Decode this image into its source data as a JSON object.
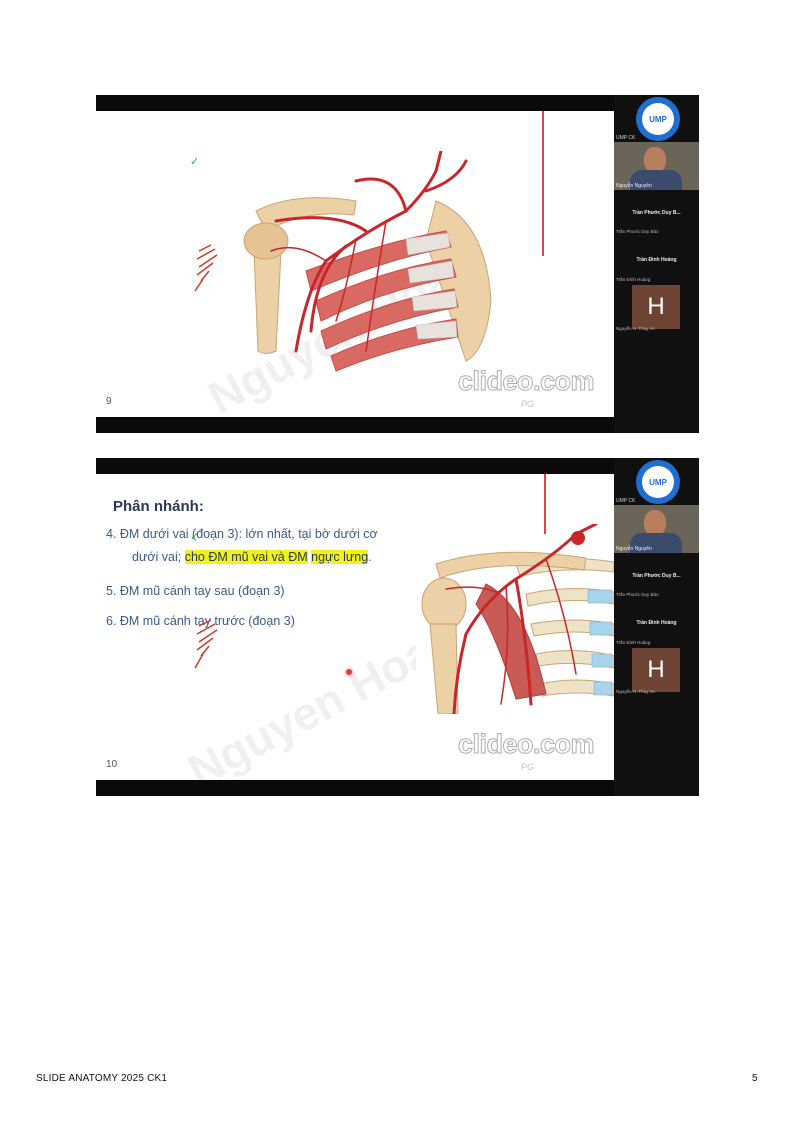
{
  "slide1": {
    "page_number": "9",
    "watermark": "clideo.com",
    "sidebar": {
      "org_label": "UMP CK",
      "camera_label": "Nguyễn Nguyên",
      "participants": [
        {
          "name": "Trần Phước Duy B...",
          "sub": "Trần Phước Duy Bảo"
        },
        {
          "name": "Trần Đình Hoàng",
          "sub": "Trần Đình Hoàng"
        }
      ],
      "avatar_letter": "H",
      "avatar_label": "Nguyễn H. Thuỵ An"
    }
  },
  "slide2": {
    "page_number": "10",
    "heading": "Phân nhánh:",
    "items": {
      "item4_line1": "4. ĐM dưới vai (đoạn 3): lớn nhất, tại bờ dưới cơ",
      "item4_line2_pre": "dưới vai; ",
      "item4_line2_hl1": "cho ĐM mũ vai và ĐM",
      "item4_line2_mid": " ",
      "item4_line2_hl2": "ngực lưng",
      "item4_line2_post": ".",
      "item5": "5. ĐM mũ cánh tay sau (đoạn 3)",
      "item6": "6. ĐM mũ cánh tay trước (đoạn 3)"
    },
    "watermark_text": "Nguyen Hoa",
    "clideo": "clideo.com",
    "sidebar": {
      "org_label": "UMP CK",
      "camera_label": "Nguyễn Nguyên",
      "participants": [
        {
          "name": "Trần Phước Duy B...",
          "sub": "Trần Phước Duy Bảo"
        },
        {
          "name": "Trần Đình Hoàng",
          "sub": "Trần Đình Hoàng"
        }
      ],
      "avatar_letter": "H",
      "avatar_label": "Nguyễn H. Thuỵ An"
    }
  },
  "footer": {
    "title": "SLIDE ANATOMY 2025 CK1",
    "page": "5"
  },
  "colors": {
    "highlight": "#f3f11c",
    "artery": "#c8262b",
    "bone": "#e9c89b",
    "muscle": "#c95a55"
  }
}
